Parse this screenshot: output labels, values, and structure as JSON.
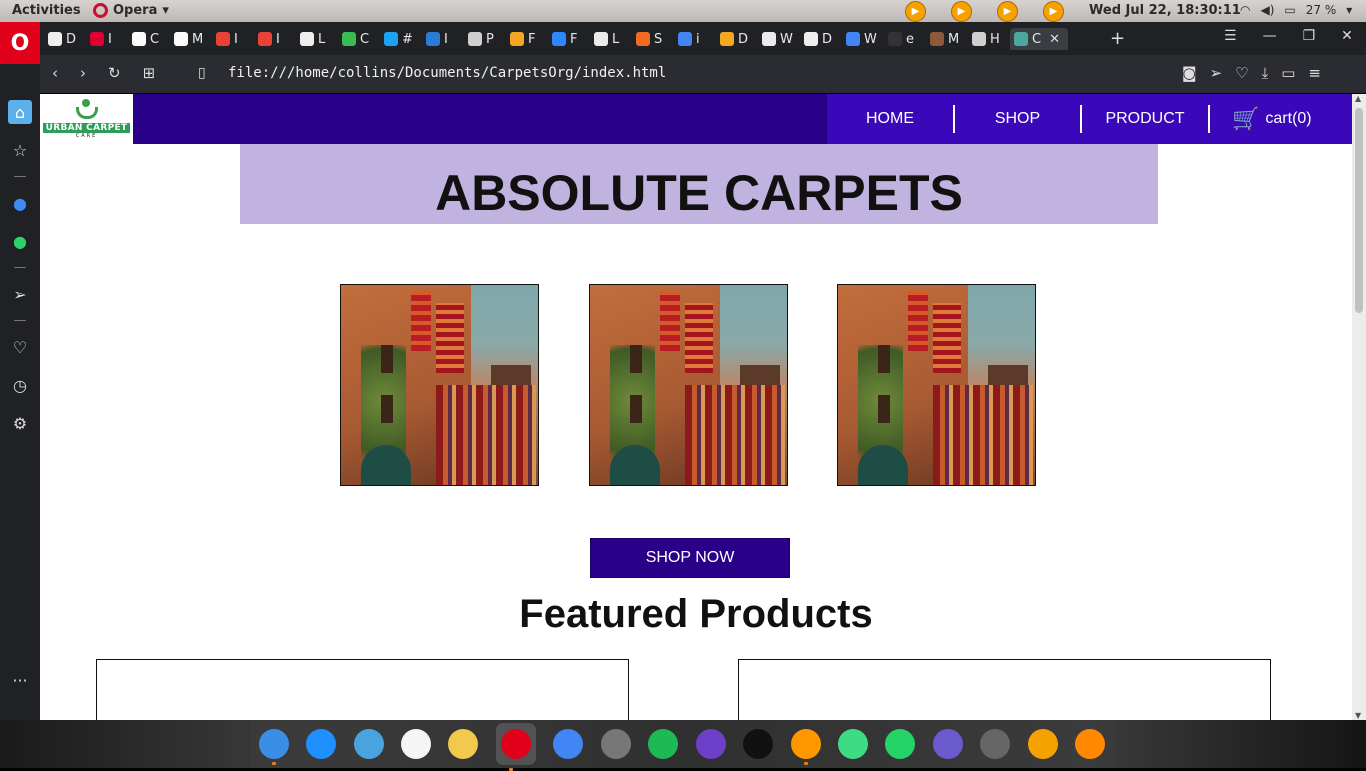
{
  "system_bar": {
    "activities": "Activities",
    "app_name": "Opera",
    "clock": "Wed Jul 22, 18:30:11",
    "battery": "27 %"
  },
  "browser": {
    "tabs": [
      {
        "label": "D",
        "icon": "generic-favicon"
      },
      {
        "label": "I",
        "icon": "angular-icon"
      },
      {
        "label": "C",
        "icon": "github-icon"
      },
      {
        "label": "M",
        "icon": "github-icon"
      },
      {
        "label": "I",
        "icon": "gmail-icon"
      },
      {
        "label": "I",
        "icon": "gmail-icon"
      },
      {
        "label": "L",
        "icon": "generic-favicon"
      },
      {
        "label": "C",
        "icon": "chart-icon"
      },
      {
        "label": "#",
        "icon": "twitter-icon"
      },
      {
        "label": "I",
        "icon": "person-icon"
      },
      {
        "label": "P",
        "icon": "cb-icon"
      },
      {
        "label": "F",
        "icon": "flame-icon"
      },
      {
        "label": "F",
        "icon": "blue-icon"
      },
      {
        "label": "L",
        "icon": "document-icon"
      },
      {
        "label": "S",
        "icon": "dev-icon"
      },
      {
        "label": "i",
        "icon": "google-icon"
      },
      {
        "label": "D",
        "icon": "flame-icon"
      },
      {
        "label": "W",
        "icon": "document-icon"
      },
      {
        "label": "D",
        "icon": "generic-favicon"
      },
      {
        "label": "W",
        "icon": "google-icon"
      },
      {
        "label": "e",
        "icon": "dark-icon"
      },
      {
        "label": "M",
        "icon": "photo-icon"
      },
      {
        "label": "H",
        "icon": "cb-icon"
      }
    ],
    "active_tab": {
      "label": "C",
      "icon": "carpet-favicon"
    },
    "url": "file:///home/collins/Documents/CarpetsOrg/index.html"
  },
  "site": {
    "brand_name": "URBAN CARPET",
    "brand_sub": "CARE",
    "nav": {
      "home": "HOME",
      "shop": "SHOP",
      "product": "PRODUCT",
      "cart": "cart(0)"
    },
    "hero_title": "ABSOLUTE CARPETS",
    "shop_now": "SHOP NOW",
    "featured_title": "Featured Products",
    "colors": {
      "nav_bg": "#2b0088",
      "menu_bg": "#3a08b8",
      "hero_bg": "#c1b3e0"
    }
  },
  "dock": {
    "apps": [
      "finder-icon",
      "app-store-icon",
      "safari-icon",
      "music-icon",
      "photos-icon",
      "opera-icon",
      "chrome-icon",
      "settings-icon",
      "spotify-icon",
      "github-desktop-icon",
      "terminal-icon",
      "sublime-icon",
      "android-studio-icon",
      "whatsapp-icon",
      "cube-icon",
      "truck-icon",
      "plex-icon",
      "vlc-icon"
    ]
  }
}
